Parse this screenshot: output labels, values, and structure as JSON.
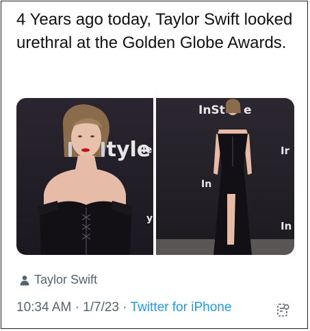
{
  "tweet": {
    "text": "4 Years ago today, Taylor Swift looked urethral at the Golden Globe Awards.",
    "media": {
      "left_backdrop": "Style",
      "left_backdrop_small_1": "le",
      "left_backdrop_small_2": "yle",
      "right_backdrop_top": "InSt",
      "right_backdrop_top_tail": "e",
      "right_backdrop_mid": "In",
      "right_backdrop_side_1": "Ir",
      "right_backdrop_side_2": "In"
    },
    "tagged_user": "Taylor Swift",
    "time": "10:34 AM",
    "separator": "·",
    "date": "1/7/23",
    "source": "Twitter for iPhone"
  },
  "icons": {
    "person": "person-icon",
    "analytics": "analytics-icon"
  },
  "colors": {
    "text": "#111111",
    "meta": "#536471",
    "link": "#1d9bf0",
    "border": "#202020"
  }
}
